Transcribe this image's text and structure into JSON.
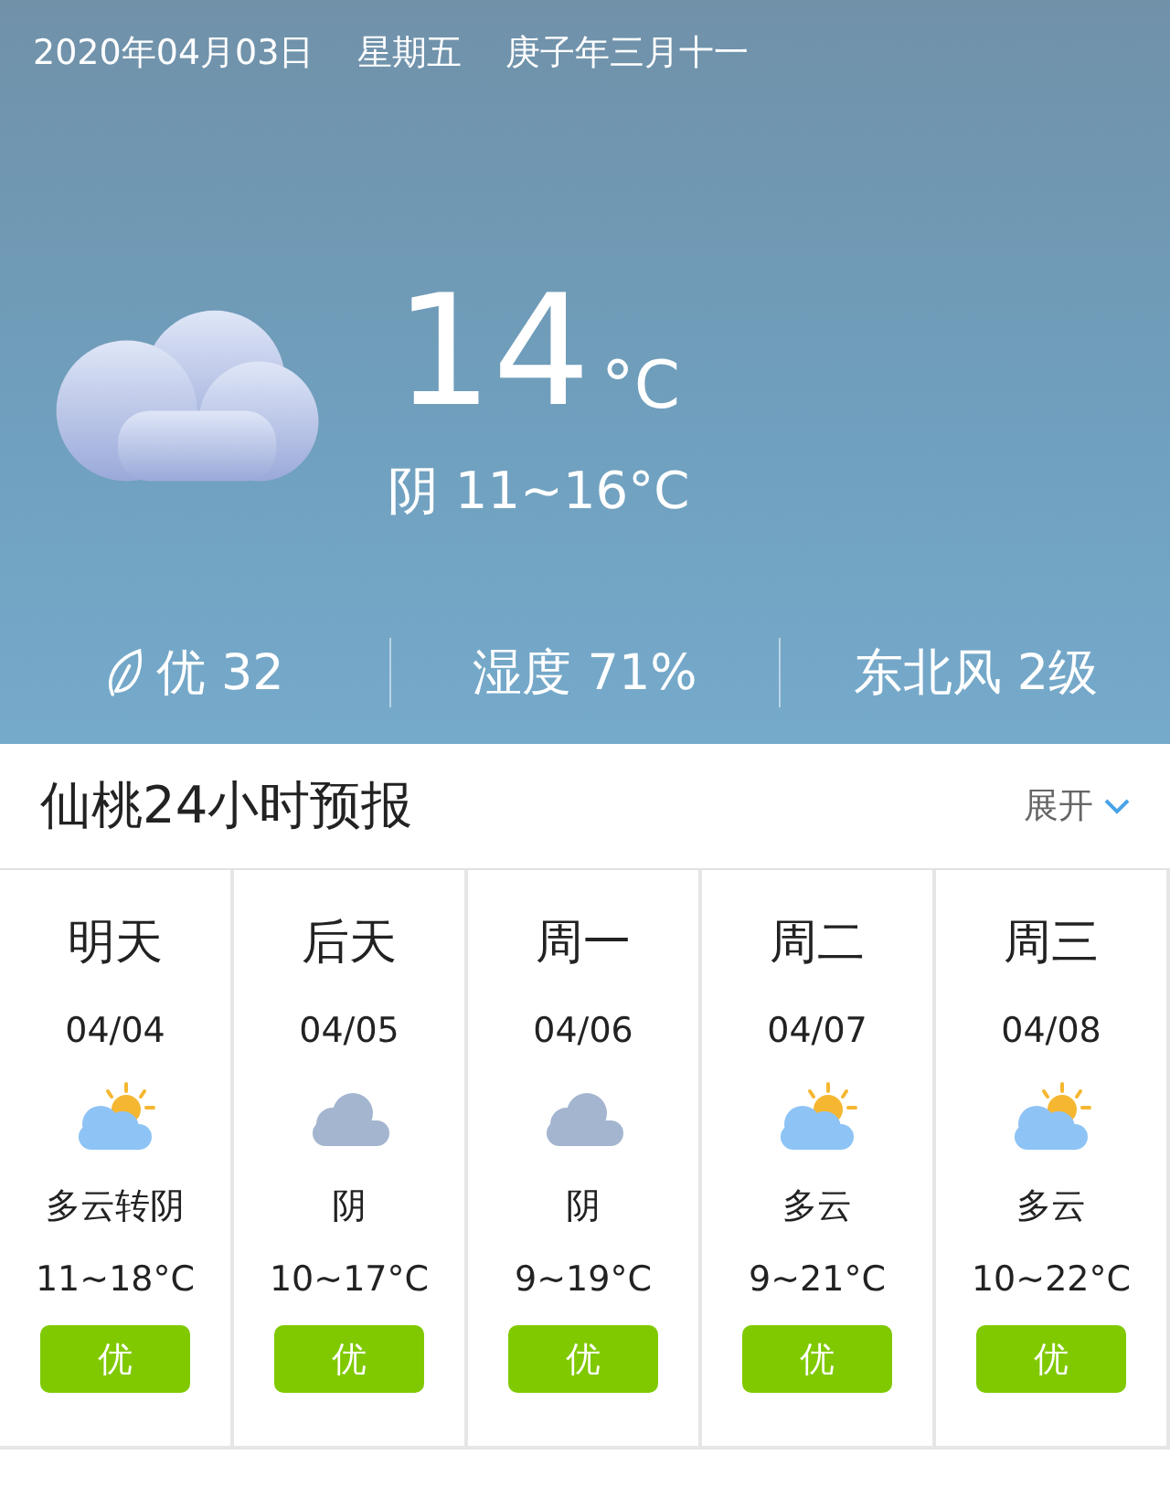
{
  "header": {
    "date": "2020年04月03日",
    "weekday": "星期五",
    "lunar": "庚子年三月十一"
  },
  "current": {
    "temp": "14",
    "unit": "°C",
    "summary": "阴 11~16°C"
  },
  "stats": [
    {
      "kind": "air",
      "text": "优 32"
    },
    {
      "kind": "plain",
      "text": "湿度 71%"
    },
    {
      "kind": "plain",
      "text": "东北风 2级"
    }
  ],
  "forecast": {
    "title": "仙桃24小时预报",
    "toggle": "展开",
    "days": [
      {
        "day": "明天",
        "date": "04/04",
        "kind": "partly-cloudy",
        "desc": "多云转阴",
        "range": "11~18°C",
        "aqi": "优"
      },
      {
        "day": "后天",
        "date": "04/05",
        "kind": "cloudy",
        "desc": "阴",
        "range": "10~17°C",
        "aqi": "优"
      },
      {
        "day": "周一",
        "date": "04/06",
        "kind": "cloudy",
        "desc": "阴",
        "range": "9~19°C",
        "aqi": "优"
      },
      {
        "day": "周二",
        "date": "04/07",
        "kind": "partly-cloudy",
        "desc": "多云",
        "range": "9~21°C",
        "aqi": "优"
      },
      {
        "day": "周三",
        "date": "04/08",
        "kind": "partly-cloudy",
        "desc": "多云",
        "range": "10~22°C",
        "aqi": "优"
      }
    ]
  }
}
